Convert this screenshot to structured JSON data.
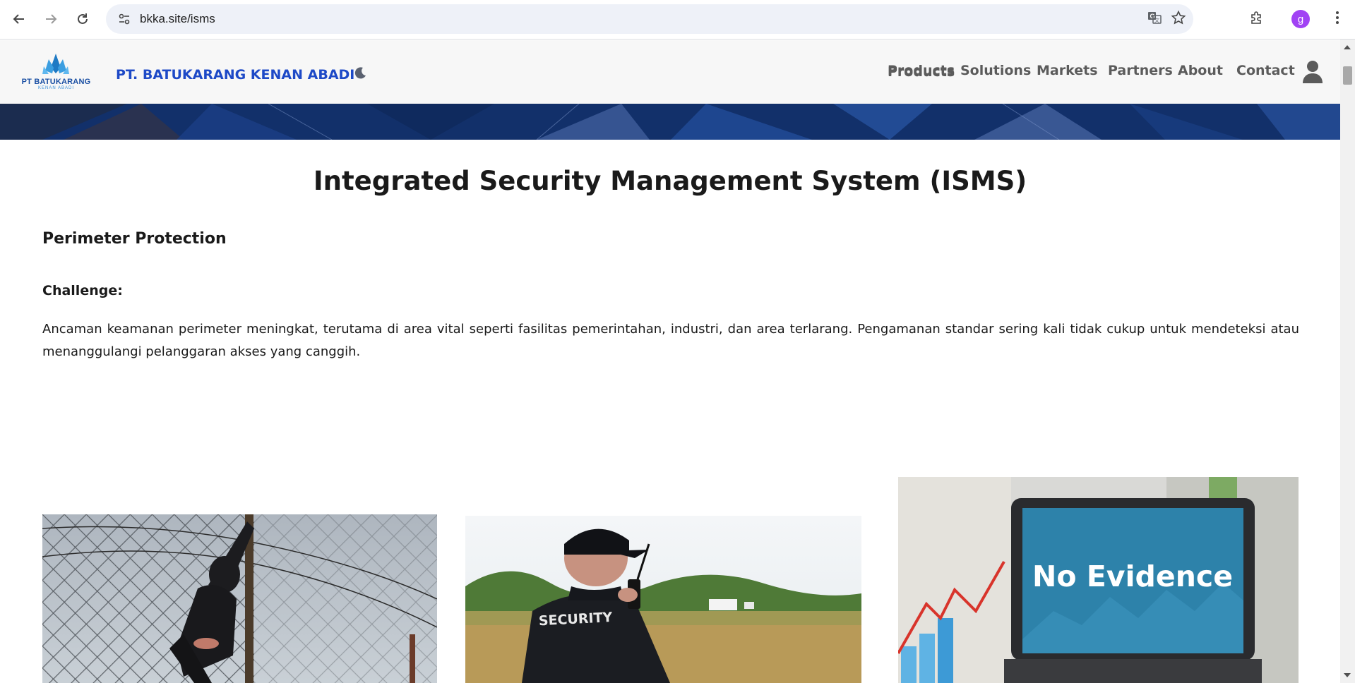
{
  "browser": {
    "url": "bkka.site/isms",
    "profile_initial": "g"
  },
  "header": {
    "logo_text": "PT BATUKARANG",
    "logo_subtext": "KENAN ABADI",
    "brand": "PT. BATUKARANG KENAN ABADI",
    "menu": [
      {
        "label": "Products"
      },
      {
        "label": "Solutions"
      },
      {
        "label": "Markets"
      },
      {
        "label": "Partners"
      },
      {
        "label": "About"
      },
      {
        "label": "Contact"
      }
    ]
  },
  "main": {
    "title": "Integrated Security Management System (ISMS)",
    "section_title": "Perimeter Protection",
    "challenge_label": "Challenge:",
    "challenge_text": "Ancaman keamanan perimeter meningkat, terutama di area vital seperti fasilitas pemerintahan, industri, dan area terlarang. Pengamanan standar sering kali tidak cukup untuk mendeteksi atau menanggulangi pelanggaran akses yang canggih.",
    "images": [
      {
        "name": "fence-intruder-image"
      },
      {
        "name": "security-guard-image",
        "caption": "SECURITY"
      },
      {
        "name": "no-evidence-laptop-image",
        "caption": "No Evidence"
      }
    ]
  },
  "colors": {
    "brand": "#1d49c7",
    "banner": "#12306a",
    "header_bg": "#f7f7f7",
    "menu_text": "#5b5b5b"
  }
}
